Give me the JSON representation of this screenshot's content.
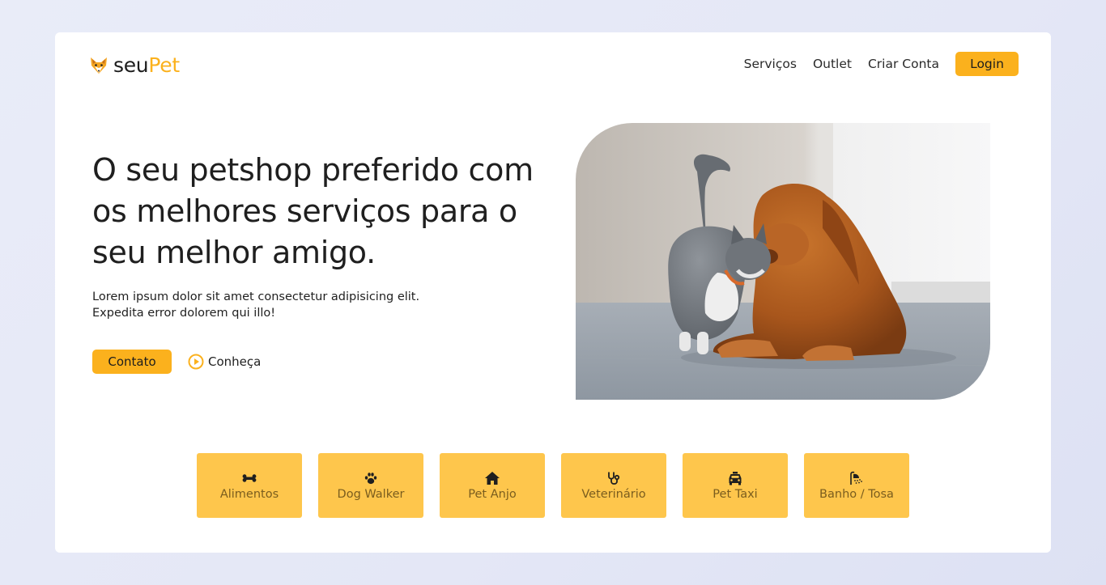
{
  "brand": {
    "prefix": "seu",
    "accent": "Pet",
    "icon": "fox-icon",
    "accent_color": "#fbb11d"
  },
  "nav": {
    "links": [
      "Serviços",
      "Outlet",
      "Criar Conta"
    ],
    "login_label": "Login"
  },
  "hero": {
    "headline": "O seu petshop preferido com os melhores serviços para o seu melhor amigo.",
    "description": "Lorem ipsum dolor sit amet consectetur adipisicing elit. Expedita error dolorem qui illo!",
    "contato_label": "Contato",
    "conheca_label": "Conheça",
    "image_subject": "cat-and-dog-photo"
  },
  "services": [
    {
      "label": "Alimentos",
      "icon": "bone-icon"
    },
    {
      "label": "Dog Walker",
      "icon": "paw-icon"
    },
    {
      "label": "Pet Anjo",
      "icon": "home-icon"
    },
    {
      "label": "Veterinário",
      "icon": "stethoscope-icon"
    },
    {
      "label": "Pet Taxi",
      "icon": "taxi-icon"
    },
    {
      "label": "Banho / Tosa",
      "icon": "shower-icon"
    }
  ],
  "colors": {
    "primary": "#fbb11d",
    "service_tile": "#fec64c",
    "text": "#1f1f1f"
  }
}
